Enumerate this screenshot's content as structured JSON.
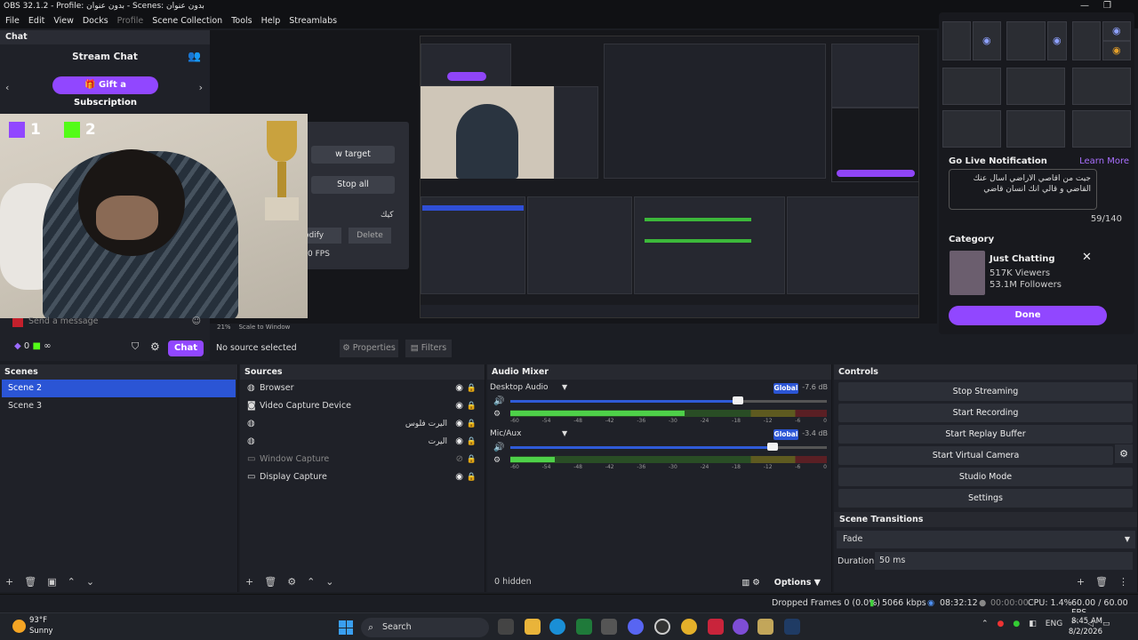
{
  "titlebar": {
    "title": "OBS 32.1.2 - Profile: بدون عنوان - Scenes: بدون عنوان"
  },
  "menu": [
    "File",
    "Edit",
    "View",
    "Docks",
    "Profile",
    "Scene Collection",
    "Tools",
    "Help",
    "Streamlabs"
  ],
  "chat": {
    "dock_title": "Chat",
    "header": "Stream Chat",
    "gift_button": "Gift a Subscription",
    "send_placeholder": "Send a message",
    "points": "0",
    "points_k": "∞",
    "chat_button": "Chat",
    "overlay_counts": [
      "1",
      "2"
    ]
  },
  "preview": {
    "add_target": "w target",
    "stop_all": "Stop all",
    "modify": "odify",
    "delete": "Delete",
    "fps": "0 FPS",
    "arabic_label": "كيك",
    "zoom": "21%",
    "scale": "Scale to Window"
  },
  "source_toolbar": {
    "no_source": "No source selected",
    "properties": "Properties",
    "filters": "Filters"
  },
  "golive": {
    "title": "Go Live Notification",
    "learn_more": "Learn More",
    "message": "جيت من اقاصي الاراضي اسال عنك القاضي و قالي انك انسان قاضي",
    "count": "59/140",
    "category_title": "Category",
    "category_name": "Just Chatting",
    "viewers": "517K Viewers",
    "followers": "53.1M Followers",
    "done": "Done"
  },
  "scenes": {
    "title": "Scenes",
    "items": [
      "Scene 2",
      "Scene 3"
    ],
    "selected": 0
  },
  "sources": {
    "title": "Sources",
    "items": [
      {
        "name": "Browser",
        "icon": "browser-icon",
        "rtl": ""
      },
      {
        "name": "Video Capture Device",
        "icon": "camera-icon",
        "rtl": ""
      },
      {
        "name": "",
        "icon": "browser-icon",
        "rtl": "اليرت فلوس"
      },
      {
        "name": "",
        "icon": "browser-icon",
        "rtl": "اليرت"
      },
      {
        "name": "Window Capture",
        "icon": "window-icon",
        "rtl": ""
      },
      {
        "name": "Display Capture",
        "icon": "monitor-icon",
        "rtl": ""
      }
    ]
  },
  "mixer": {
    "title": "Audio Mixer",
    "channels": [
      {
        "name": "Desktop Audio",
        "db": "-7.6 dB",
        "global": "Global",
        "volume": 0.72,
        "level": 0.55
      },
      {
        "name": "Mic/Aux",
        "db": "-3.4 dB",
        "global": "Global",
        "volume": 0.83,
        "level": 0.14
      }
    ],
    "ticks": [
      "-60",
      "-54",
      "-48",
      "-42",
      "-36",
      "-30",
      "-24",
      "-18",
      "-12",
      "-6",
      "0"
    ],
    "hidden": "0 hidden",
    "options": "Options"
  },
  "controls": {
    "title": "Controls",
    "buttons": [
      "Stop Streaming",
      "Start Recording",
      "Start Replay Buffer",
      "Start Virtual Camera",
      "Studio Mode",
      "Settings"
    ],
    "transitions_title": "Scene Transitions",
    "transition": "Fade",
    "duration_label": "Duration",
    "duration": "50 ms"
  },
  "status": {
    "dropped": "Dropped Frames 0 (0.0%)",
    "kbps": "5066 kbps",
    "stream_time": "08:32:12",
    "rec_time": "00:00:00",
    "cpu": "CPU: 1.4%",
    "fps": "60.00 / 60.00 FPS"
  },
  "taskbar": {
    "temp": "93°F",
    "condition": "Sunny",
    "search": "Search",
    "lang": "ENG",
    "time": "8:45 AM",
    "date": "8/2/2026"
  }
}
